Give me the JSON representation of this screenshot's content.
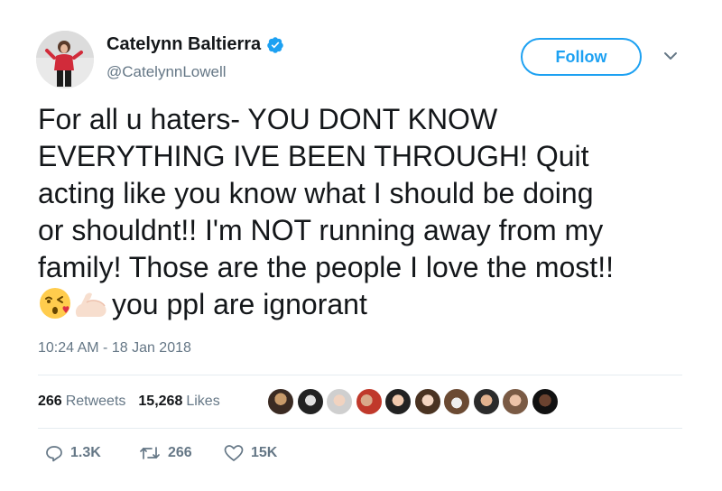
{
  "user": {
    "display_name": "Catelynn Baltierra",
    "handle": "@CatelynnLowell",
    "verified_icon": "verified-badge-icon"
  },
  "follow_label": "Follow",
  "tweet": {
    "lines": [
      "For all u haters- YOU DONT KNOW",
      "EVERYTHING IVE BEEN THROUGH! Quit",
      "acting like you know what I should be doing",
      "or shouldnt!! I'm NOT running away from my",
      "family! Those are the people I love the most!!"
    ],
    "last_line_text": "you ppl are ignorant",
    "emojis": [
      "face-blowing-kiss-emoji",
      "flexed-biceps-emoji"
    ]
  },
  "timestamp": "10:24 AM - 18 Jan 2018",
  "stats": {
    "retweets_count": "266",
    "retweets_label": "Retweets",
    "likes_count": "15,268",
    "likes_label": "Likes"
  },
  "likers_count_shown": 10,
  "actions": {
    "replies": "1.3K",
    "retweets": "266",
    "likes": "15K"
  },
  "colors": {
    "accent": "#1da1f2",
    "text": "#14171a",
    "muted": "#657786",
    "divider": "#e6ecf0"
  }
}
